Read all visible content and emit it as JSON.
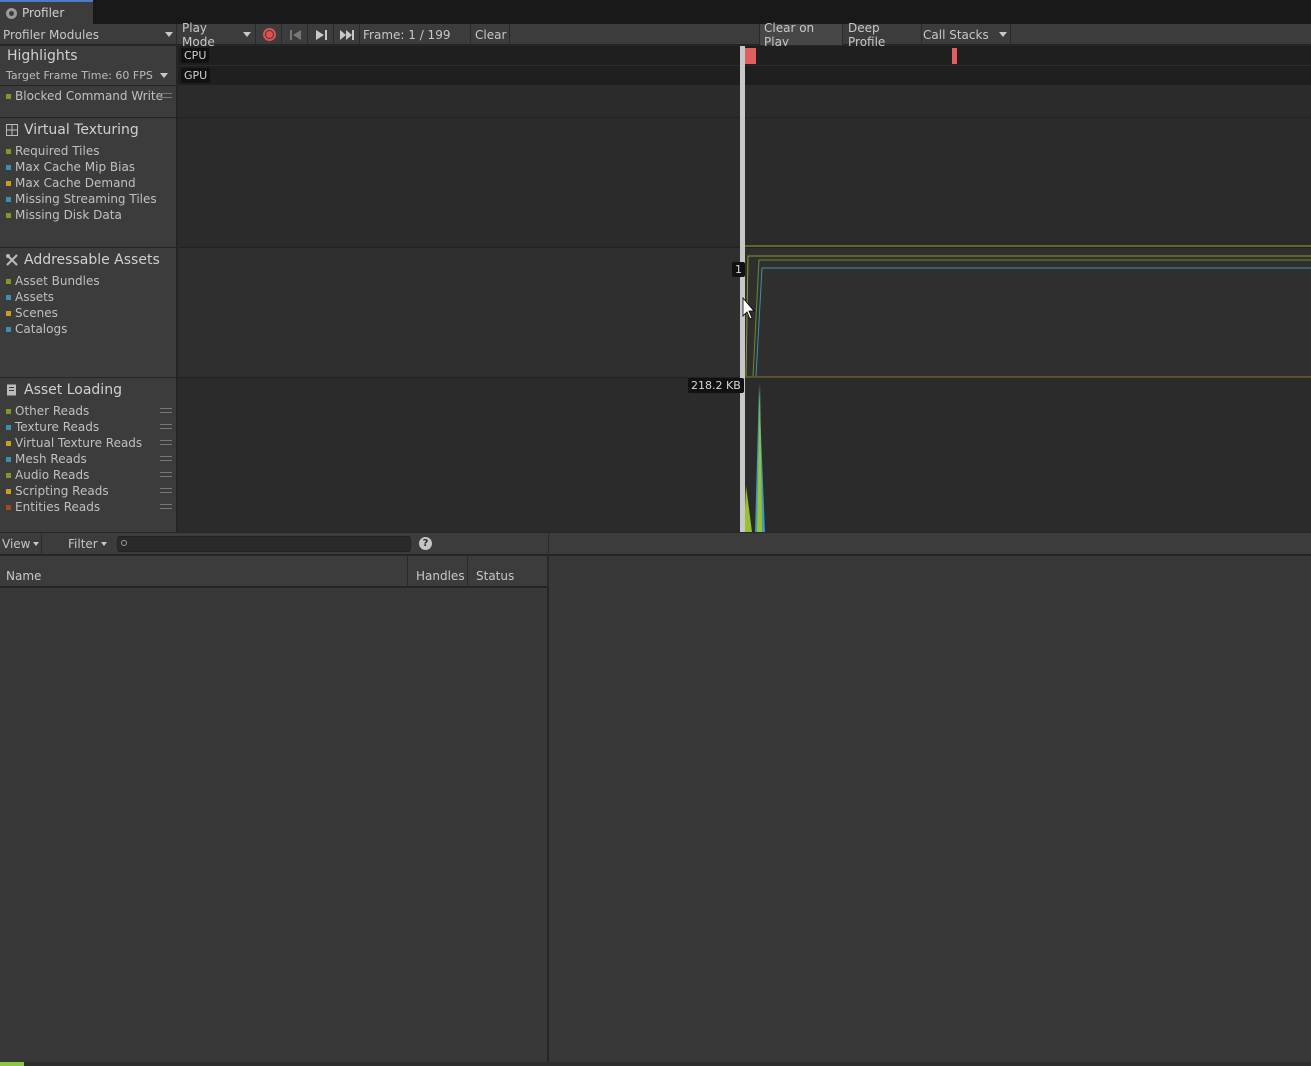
{
  "window": {
    "tab_title": "Profiler"
  },
  "toolbar": {
    "modules_label": "Profiler Modules",
    "play_mode_label": "Play Mode",
    "frame_label": "Frame: 1 / 199",
    "clear_label": "Clear",
    "clear_on_play_label": "Clear on Play",
    "deep_profile_label": "Deep Profile",
    "call_stacks_label": "Call Stacks"
  },
  "highlights": {
    "title": "Highlights",
    "target_frame_time": "Target Frame Time: 60 FPS",
    "lanes": [
      "CPU",
      "GPU"
    ],
    "series": [
      {
        "label": "Blocked Command Write",
        "color": "#7a9a2a"
      }
    ]
  },
  "modules": [
    {
      "title": "Virtual Texturing",
      "icon": "grid-icon",
      "series": [
        {
          "label": "Required Tiles",
          "color": "#7a9a2a"
        },
        {
          "label": "Max Cache Mip Bias",
          "color": "#3d8fb0"
        },
        {
          "label": "Max Cache Demand",
          "color": "#c8a020"
        },
        {
          "label": "Missing Streaming Tiles",
          "color": "#3d8fb0"
        },
        {
          "label": "Missing Disk Data",
          "color": "#7a9a2a"
        }
      ]
    },
    {
      "title": "Addressable Assets",
      "icon": "tools-icon",
      "series": [
        {
          "label": "Asset Bundles",
          "color": "#7a9a2a"
        },
        {
          "label": "Assets",
          "color": "#3d8fb0"
        },
        {
          "label": "Scenes",
          "color": "#c8a020"
        },
        {
          "label": "Catalogs",
          "color": "#3d8fb0"
        }
      ],
      "tooltip": "1"
    },
    {
      "title": "Asset Loading",
      "icon": "document-icon",
      "series": [
        {
          "label": "Other Reads",
          "color": "#7a9a2a"
        },
        {
          "label": "Texture Reads",
          "color": "#3d8fb0"
        },
        {
          "label": "Virtual Texture Reads",
          "color": "#c8a020"
        },
        {
          "label": "Mesh Reads",
          "color": "#3d8fb0"
        },
        {
          "label": "Audio Reads",
          "color": "#7a9a2a"
        },
        {
          "label": "Scripting Reads",
          "color": "#c8a020"
        },
        {
          "label": "Entities Reads",
          "color": "#a04a20"
        }
      ],
      "tooltip": "218.2 KB"
    }
  ],
  "bottom": {
    "view_label": "View",
    "filter_label": "Filter",
    "search_placeholder": "",
    "help_glyph": "?",
    "columns": {
      "name": "Name",
      "handles": "Handles",
      "status": "Status"
    }
  },
  "progress": {
    "fraction": 0.018,
    "color": "#8dc63f"
  }
}
